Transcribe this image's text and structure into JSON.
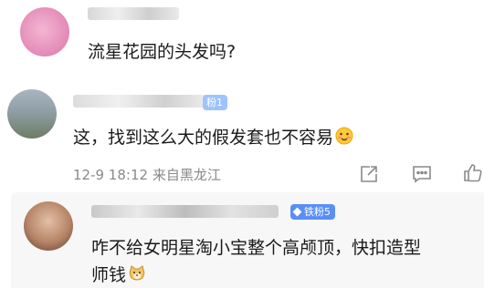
{
  "comments": [
    {
      "text": "流星花园的头发吗?"
    },
    {
      "text": "这，找到这么大的假发套也不容易",
      "badge_num": "粉1",
      "timestamp": "12-9 18:12",
      "location": "来自黑龙江",
      "actions": [
        "share-icon",
        "comment-icon",
        "like-icon"
      ]
    },
    {
      "line1": "咋不给女明星淘小宝整个高颅顶，快扣造型",
      "line2": "师钱",
      "badge": "铁粉5"
    }
  ],
  "colors": {
    "badge": "#5a8ef6",
    "meta": "#8a8a8a",
    "reply_bg": "#f7f7f7"
  }
}
